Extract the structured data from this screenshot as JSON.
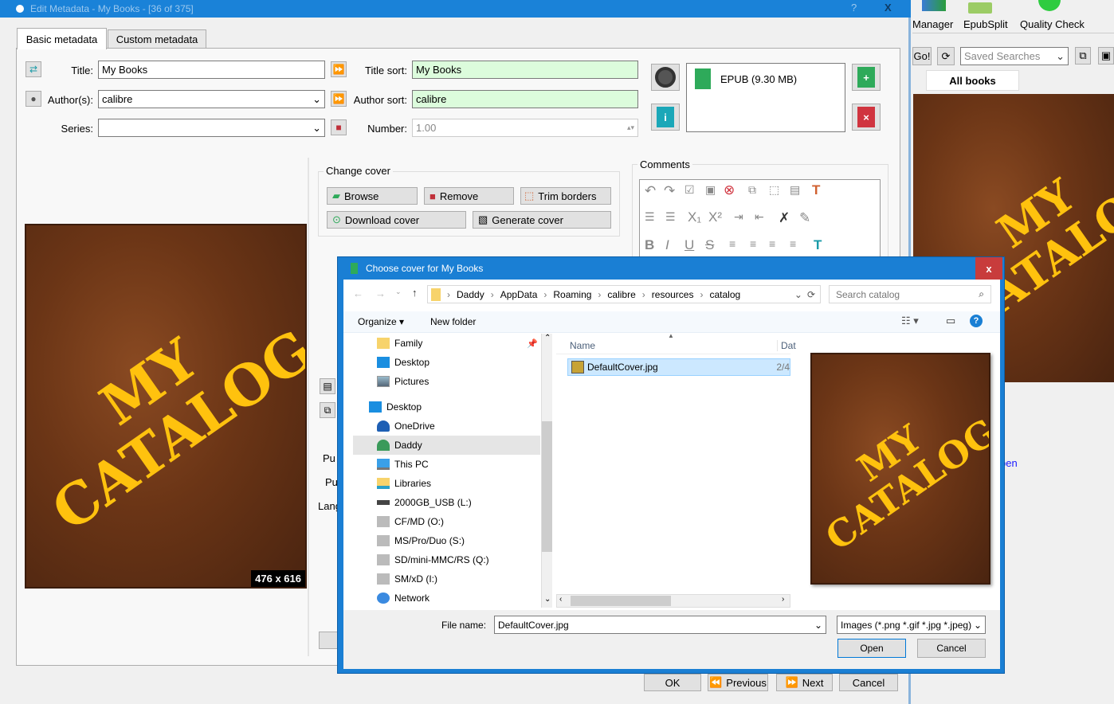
{
  "main_window": {
    "toolbar": [
      {
        "label": "Manager"
      },
      {
        "label": "EpubSplit"
      },
      {
        "label": "Quality Check"
      }
    ],
    "go_label": "Go!",
    "saved_searches_placeholder": "Saved Searches",
    "tab_all_books": "All books",
    "link_fragment": "pen"
  },
  "edit_dialog": {
    "title": "Edit Metadata - My Books -  [36 of 375]",
    "help": "?",
    "close": "X",
    "tabs": [
      {
        "label": "Basic metadata",
        "active": true
      },
      {
        "label": "Custom metadata"
      }
    ],
    "title_label": "Title:",
    "title_value": "My Books",
    "title_sort_label": "Title sort:",
    "title_sort_value": "My Books",
    "author_label": "Author(s):",
    "author_value": "calibre",
    "author_sort_label": "Author sort:",
    "author_sort_value": "calibre",
    "series_label": "Series:",
    "series_value": "",
    "number_label": "Number:",
    "number_value": "1.00",
    "format": "EPUB (9.30 MB)",
    "cover_size": "476 x 616",
    "change_cover": {
      "title": "Change cover",
      "browse": "Browse",
      "remove": "Remove",
      "trim": "Trim borders",
      "download": "Download cover",
      "generate": "Generate cover"
    },
    "comments_title": "Comments",
    "partial_labels": [
      "Pu",
      "Pu",
      "Lang"
    ],
    "buttons": {
      "ok": "OK",
      "previous": "Previous",
      "next": "Next",
      "cancel": "Cancel"
    }
  },
  "cover_text": [
    "MY",
    "CATALOG"
  ],
  "file_dialog": {
    "title": "Choose cover for My Books",
    "close": "x",
    "breadcrumb": [
      "Daddy",
      "AppData",
      "Roaming",
      "calibre",
      "resources",
      "catalog"
    ],
    "search_placeholder": "Search catalog",
    "organize": "Organize",
    "new_folder": "New folder",
    "nav": [
      {
        "label": "Family",
        "icon": "folder-icon",
        "indent": 1
      },
      {
        "label": "Desktop",
        "icon": "desktop-icon",
        "indent": 1
      },
      {
        "label": "Pictures",
        "icon": "pictures-icon",
        "indent": 1
      },
      {
        "label": "Desktop",
        "icon": "desktop-icon",
        "indent": 0
      },
      {
        "label": "OneDrive",
        "icon": "cloud-icon",
        "indent": 1
      },
      {
        "label": "Daddy",
        "icon": "user-icon",
        "indent": 1,
        "selected": true
      },
      {
        "label": "This PC",
        "icon": "computer-icon",
        "indent": 1
      },
      {
        "label": "Libraries",
        "icon": "libraries-icon",
        "indent": 1
      },
      {
        "label": "2000GB_USB (L:)",
        "icon": "drive-icon",
        "indent": 1
      },
      {
        "label": "CF/MD (O:)",
        "icon": "card-icon",
        "indent": 1
      },
      {
        "label": "MS/Pro/Duo (S:)",
        "icon": "card-icon",
        "indent": 1
      },
      {
        "label": "SD/mini-MMC/RS (Q:)",
        "icon": "card-icon",
        "indent": 1
      },
      {
        "label": "SM/xD (I:)",
        "icon": "card-icon",
        "indent": 1
      },
      {
        "label": "Network",
        "icon": "network-icon",
        "indent": 1
      }
    ],
    "columns": [
      "Name",
      "Dat"
    ],
    "files": [
      {
        "name": "DefaultCover.jpg",
        "date": "2/4"
      }
    ],
    "file_name_label": "File name:",
    "file_name_value": "DefaultCover.jpg",
    "filter": "Images (*.png *.gif *.jpg *.jpeg)",
    "open": "Open",
    "cancel": "Cancel"
  }
}
